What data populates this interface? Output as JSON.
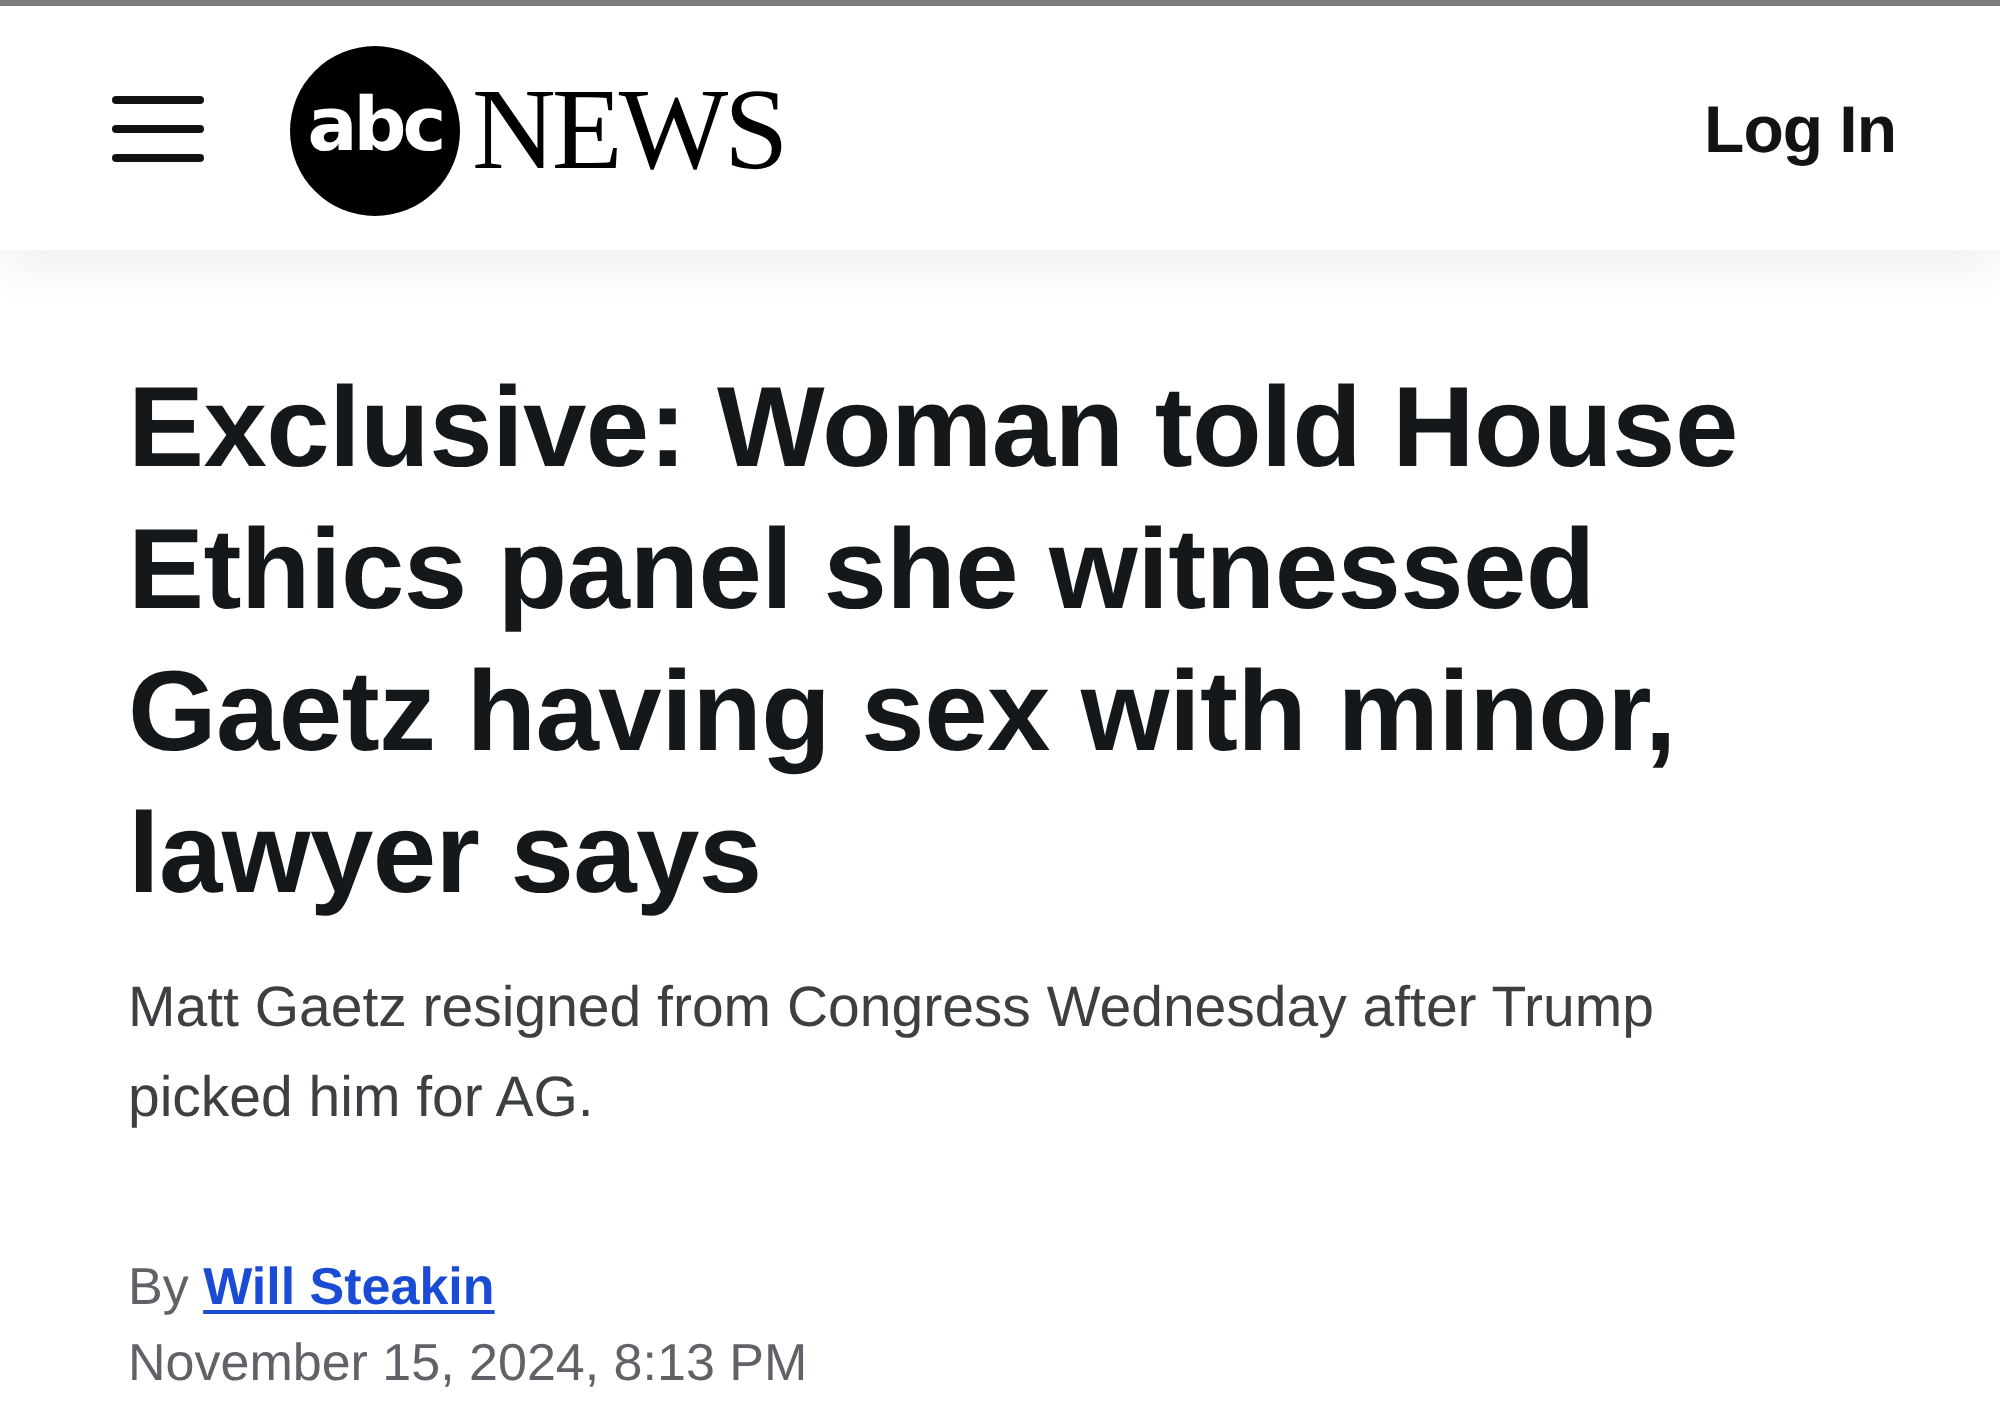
{
  "header": {
    "logo": {
      "badge_text": "abc",
      "wordmark": "NEWS"
    },
    "login_label": "Log In"
  },
  "article": {
    "headline": "Exclusive: Woman told House Ethics panel she witnessed Gaetz having sex with minor, lawyer says",
    "subheadline": "Matt Gaetz resigned from Congress Wednesday after Trump picked him for AG.",
    "byline": {
      "prefix": "By",
      "author": "Will Steakin"
    },
    "timestamp": "November 15, 2024, 8:13 PM"
  }
}
